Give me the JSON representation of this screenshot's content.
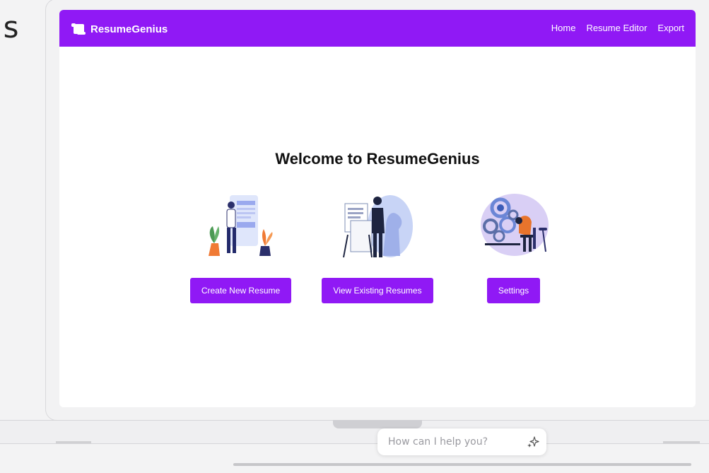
{
  "background_text": "ls",
  "app": {
    "brand": "ResumeGenius",
    "nav": [
      "Home",
      "Resume Editor",
      "Export"
    ],
    "accent_color": "#9019f5"
  },
  "main": {
    "heading": "Welcome to ResumeGenius",
    "cards": [
      {
        "button": "Create New Resume",
        "illustration": "person-with-resume-board-illustration"
      },
      {
        "button": "View Existing Resumes",
        "illustration": "person-reading-documents-illustration"
      },
      {
        "button": "Settings",
        "illustration": "person-with-gears-illustration"
      }
    ]
  },
  "assistant": {
    "placeholder": "How can I help you?",
    "icon": "sparkle-icon"
  }
}
